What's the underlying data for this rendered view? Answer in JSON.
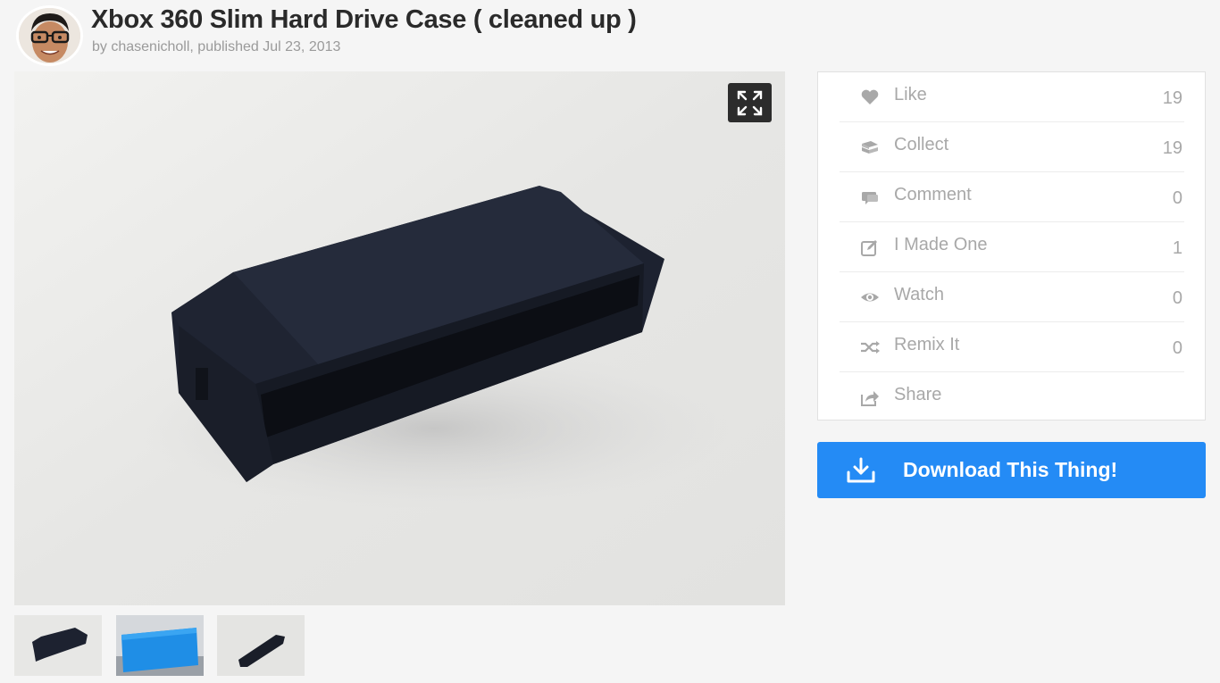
{
  "header": {
    "title": "Xbox 360 Slim Hard Drive Case ( cleaned up )",
    "byline": "by chasenicholl, published Jul 23, 2013"
  },
  "gallery": {
    "expand_icon": "expand-icon",
    "thumbnails": [
      "thumbnail-1",
      "thumbnail-2",
      "thumbnail-3"
    ]
  },
  "actions": [
    {
      "label": "Like",
      "count": "19",
      "icon": "heart-icon"
    },
    {
      "label": "Collect",
      "count": "19",
      "icon": "collect-icon"
    },
    {
      "label": "Comment",
      "count": "0",
      "icon": "comment-icon"
    },
    {
      "label": "I Made One",
      "count": "1",
      "icon": "made-one-icon"
    },
    {
      "label": "Watch",
      "count": "0",
      "icon": "eye-icon"
    },
    {
      "label": "Remix It",
      "count": "0",
      "icon": "remix-icon"
    },
    {
      "label": "Share",
      "count": "",
      "icon": "share-icon"
    }
  ],
  "download": {
    "label": "Download This Thing!",
    "icon": "download-icon"
  },
  "colors": {
    "accent": "#248bf5",
    "muted_text": "#a8a8a8",
    "background": "#f5f5f5"
  }
}
